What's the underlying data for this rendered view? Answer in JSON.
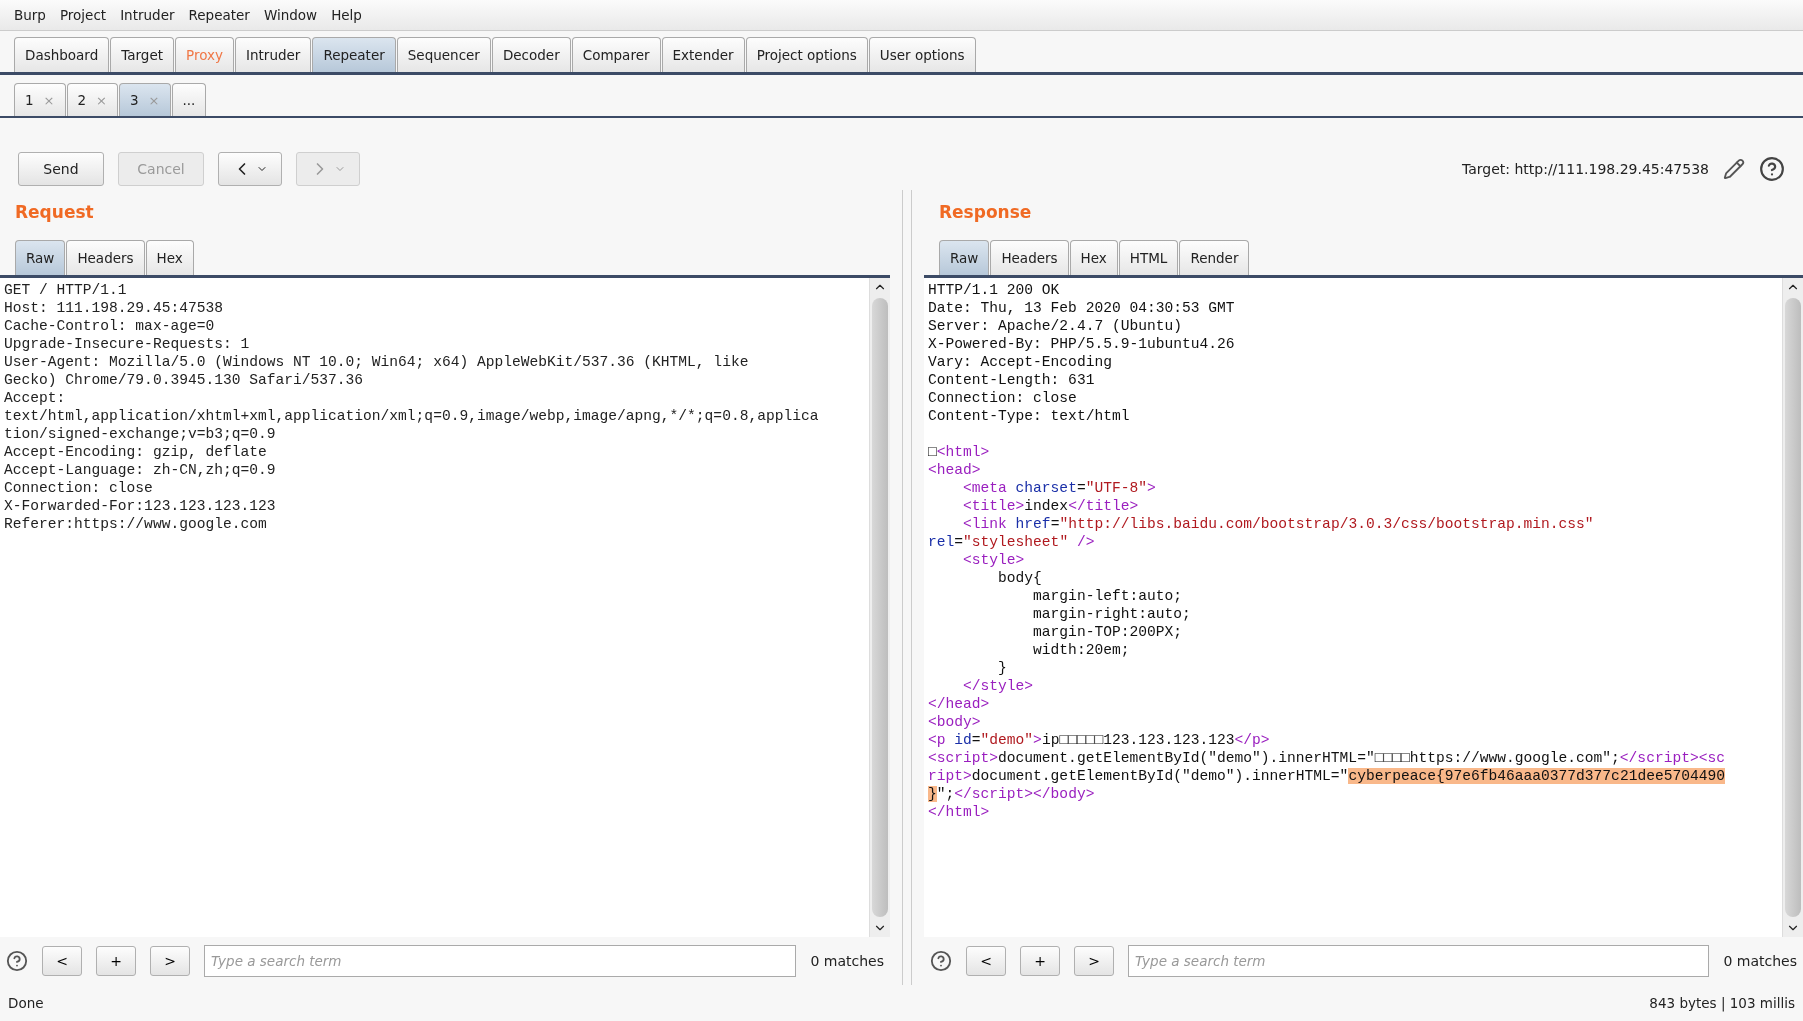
{
  "menu": [
    "Burp",
    "Project",
    "Intruder",
    "Repeater",
    "Window",
    "Help"
  ],
  "main_tabs": [
    {
      "label": "Dashboard",
      "selected": false,
      "highlighted": false
    },
    {
      "label": "Target",
      "selected": false,
      "highlighted": false
    },
    {
      "label": "Proxy",
      "selected": false,
      "highlighted": true
    },
    {
      "label": "Intruder",
      "selected": false,
      "highlighted": false
    },
    {
      "label": "Repeater",
      "selected": true,
      "highlighted": false
    },
    {
      "label": "Sequencer",
      "selected": false,
      "highlighted": false
    },
    {
      "label": "Decoder",
      "selected": false,
      "highlighted": false
    },
    {
      "label": "Comparer",
      "selected": false,
      "highlighted": false
    },
    {
      "label": "Extender",
      "selected": false,
      "highlighted": false
    },
    {
      "label": "Project options",
      "selected": false,
      "highlighted": false
    },
    {
      "label": "User options",
      "selected": false,
      "highlighted": false
    }
  ],
  "repeater_tabs": [
    {
      "label": "1",
      "close": "×",
      "selected": false
    },
    {
      "label": "2",
      "close": "×",
      "selected": false
    },
    {
      "label": "3",
      "close": "×",
      "selected": true
    },
    {
      "label": "...",
      "selected": false
    }
  ],
  "toolbar": [
    {
      "kind": "text",
      "label": "Send",
      "disabled": false
    },
    {
      "kind": "text",
      "label": "Cancel",
      "disabled": true
    },
    {
      "kind": "back",
      "disabled": false
    },
    {
      "kind": "forward",
      "disabled": true
    }
  ],
  "target": "Target: http://111.198.29.45:47538",
  "request": {
    "title": "Request",
    "tabs": [
      {
        "label": "Raw",
        "selected": true
      },
      {
        "label": "Headers",
        "selected": false
      },
      {
        "label": "Hex",
        "selected": false
      }
    ],
    "lines": [
      "GET / HTTP/1.1",
      "Host: 111.198.29.45:47538",
      "Cache-Control: max-age=0",
      "Upgrade-Insecure-Requests: 1",
      "User-Agent: Mozilla/5.0 (Windows NT 10.0; Win64; x64) AppleWebKit/537.36 (KHTML, like",
      "Gecko) Chrome/79.0.3945.130 Safari/537.36",
      "Accept:",
      "text/html,application/xhtml+xml,application/xml;q=0.9,image/webp,image/apng,*/*;q=0.8,applica",
      "tion/signed-exchange;v=b3;q=0.9",
      "Accept-Encoding: gzip, deflate",
      "Accept-Language: zh-CN,zh;q=0.9",
      "Connection: close",
      "X-Forwarded-For:123.123.123.123",
      "Referer:https://www.google.com"
    ],
    "search": {
      "buttons": [
        "<",
        "+",
        ">"
      ],
      "placeholder": "Type a search term",
      "matches": "0 matches"
    }
  },
  "response": {
    "title": "Response",
    "tabs": [
      {
        "label": "Raw",
        "selected": true
      },
      {
        "label": "Headers",
        "selected": false
      },
      {
        "label": "Hex",
        "selected": false
      },
      {
        "label": "HTML",
        "selected": false
      },
      {
        "label": "Render",
        "selected": false
      }
    ],
    "lines": [
      {
        "segments": [
          {
            "kind": "plain",
            "text": "HTTP/1.1 200 OK"
          }
        ]
      },
      {
        "segments": [
          {
            "kind": "plain",
            "text": "Date: Thu, 13 Feb 2020 04:30:53 GMT"
          }
        ]
      },
      {
        "segments": [
          {
            "kind": "plain",
            "text": "Server: Apache/2.4.7 (Ubuntu)"
          }
        ]
      },
      {
        "segments": [
          {
            "kind": "plain",
            "text": "X-Powered-By: PHP/5.5.9-1ubuntu4.26"
          }
        ]
      },
      {
        "segments": [
          {
            "kind": "plain",
            "text": "Vary: Accept-Encoding"
          }
        ]
      },
      {
        "segments": [
          {
            "kind": "plain",
            "text": "Content-Length: 631"
          }
        ]
      },
      {
        "segments": [
          {
            "kind": "plain",
            "text": "Connection: close"
          }
        ]
      },
      {
        "segments": [
          {
            "kind": "plain",
            "text": "Content-Type: text/html"
          }
        ]
      },
      {
        "blank_before": true,
        "segments": [
          {
            "kind": "plain",
            "text": "□"
          },
          {
            "kind": "tag",
            "text": "<html>"
          }
        ]
      },
      {
        "segments": [
          {
            "kind": "tag",
            "text": "<head>"
          }
        ]
      },
      {
        "segments": [
          {
            "kind": "tag",
            "text": "    <meta"
          },
          {
            "kind": "attr",
            "text": " charset"
          },
          {
            "kind": "plain",
            "text": "="
          },
          {
            "kind": "value",
            "text": "\"UTF-8\""
          },
          {
            "kind": "tag",
            "text": ">"
          }
        ]
      },
      {
        "segments": [
          {
            "kind": "tag",
            "text": "    <title>"
          },
          {
            "kind": "plain",
            "text": "index"
          },
          {
            "kind": "tag",
            "text": "</title>"
          }
        ]
      },
      {
        "segments": [
          {
            "kind": "tag",
            "text": "    <link"
          },
          {
            "kind": "attr",
            "text": " href"
          },
          {
            "kind": "plain",
            "text": "="
          },
          {
            "kind": "value",
            "text": "\"http://libs.baidu.com/bootstrap/3.0.3/css/bootstrap.min.css\""
          }
        ]
      },
      {
        "segments": [
          {
            "kind": "attr",
            "text": "rel"
          },
          {
            "kind": "plain",
            "text": "="
          },
          {
            "kind": "value",
            "text": "\"stylesheet\""
          },
          {
            "kind": "tag",
            "text": " />"
          }
        ]
      },
      {
        "segments": [
          {
            "kind": "tag",
            "text": "    <style>"
          }
        ]
      },
      {
        "segments": [
          {
            "kind": "plain",
            "text": "        body{"
          }
        ]
      },
      {
        "segments": [
          {
            "kind": "plain",
            "text": "            margin-left:auto;"
          }
        ]
      },
      {
        "segments": [
          {
            "kind": "plain",
            "text": "            margin-right:auto;"
          }
        ]
      },
      {
        "segments": [
          {
            "kind": "plain",
            "text": "            margin-TOP:200PX;"
          }
        ]
      },
      {
        "segments": [
          {
            "kind": "plain",
            "text": "            width:20em;"
          }
        ]
      },
      {
        "segments": [
          {
            "kind": "plain",
            "text": "        }"
          }
        ]
      },
      {
        "segments": [
          {
            "kind": "tag",
            "text": "    </style>"
          }
        ]
      },
      {
        "segments": [
          {
            "kind": "tag",
            "text": "</head>"
          }
        ]
      },
      {
        "segments": [
          {
            "kind": "tag",
            "text": "<body>"
          }
        ]
      },
      {
        "segments": [
          {
            "kind": "tag",
            "text": "<p"
          },
          {
            "kind": "attr",
            "text": " id"
          },
          {
            "kind": "plain",
            "text": "="
          },
          {
            "kind": "value",
            "text": "\"demo\""
          },
          {
            "kind": "tag",
            "text": ">"
          },
          {
            "kind": "plain",
            "text": "ip□□□□□123.123.123.123"
          },
          {
            "kind": "tag",
            "text": "</p>"
          }
        ]
      },
      {
        "segments": [
          {
            "kind": "tag",
            "text": "<script>"
          },
          {
            "kind": "plain",
            "text": "document.getElementById(\"demo\").innerHTML=\"□□□□https://www.google.com\";"
          },
          {
            "kind": "tag",
            "text": "</script><sc"
          }
        ]
      },
      {
        "segments": [
          {
            "kind": "tag",
            "text": "ript>"
          },
          {
            "kind": "plain",
            "text": "document.getElementById(\"demo\").innerHTML=\""
          },
          {
            "kind": "match",
            "text": "cyberpeace{97e6fb46aaa0377d377c21dee5704490"
          }
        ]
      },
      {
        "segments": [
          {
            "kind": "match",
            "text": "}"
          },
          {
            "kind": "plain",
            "text": "\";"
          },
          {
            "kind": "tag",
            "text": "</script></body>"
          }
        ]
      },
      {
        "segments": [
          {
            "kind": "tag",
            "text": "</html>"
          }
        ]
      }
    ],
    "search": {
      "buttons": [
        "<",
        "+",
        ">"
      ],
      "placeholder": "Type a search term",
      "matches": "0 matches"
    }
  },
  "status": {
    "left": "Done",
    "right": "843 bytes | 103 millis"
  }
}
